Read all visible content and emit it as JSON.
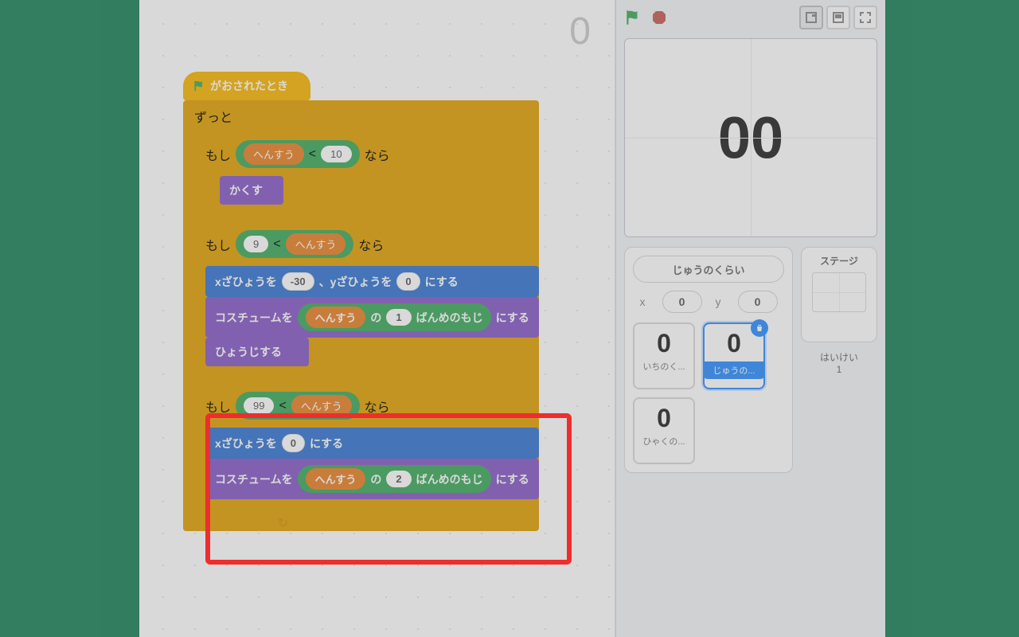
{
  "scriptCounter": "0",
  "hat": {
    "label": "がおされたとき"
  },
  "forever": "ずっと",
  "if1": {
    "if": "もし",
    "var": "へんすう",
    "lt": "<",
    "val": "10",
    "then": "なら"
  },
  "hide": "かくす",
  "if2": {
    "if": "もし",
    "val": "9",
    "lt": "<",
    "var": "へんすう",
    "then": "なら"
  },
  "goto": {
    "pre": "xざひょうを",
    "x": "-30",
    "mid": "、yざひょうを",
    "y": "0",
    "post": "にする"
  },
  "costume1": {
    "pre": "コスチュームを",
    "var": "へんすう",
    "of": "の",
    "idx": "1",
    "letter": "ばんめのもじ",
    "post": "にする"
  },
  "show": "ひょうじする",
  "if3": {
    "if": "もし",
    "val": "99",
    "lt": "<",
    "var": "へんすう",
    "then": "なら"
  },
  "setx": {
    "pre": "xざひょうを",
    "x": "0",
    "post": "にする"
  },
  "costume2": {
    "pre": "コスチュームを",
    "var": "へんすう",
    "of": "の",
    "idx": "2",
    "letter": "ばんめのもじ",
    "post": "にする"
  },
  "stage": {
    "display": "00"
  },
  "spriteName": "じゅうのくらい",
  "xy": {
    "xl": "x",
    "x": "0",
    "yl": "y",
    "y": "0"
  },
  "thumbs": {
    "a": {
      "ch": "0",
      "label": "いちのく..."
    },
    "b": {
      "ch": "0",
      "label": "じゅうの..."
    },
    "c": {
      "ch": "0",
      "label": "ひゃくの..."
    }
  },
  "stageSide": {
    "title": "ステージ",
    "haikei": "はいけい",
    "count": "1"
  }
}
